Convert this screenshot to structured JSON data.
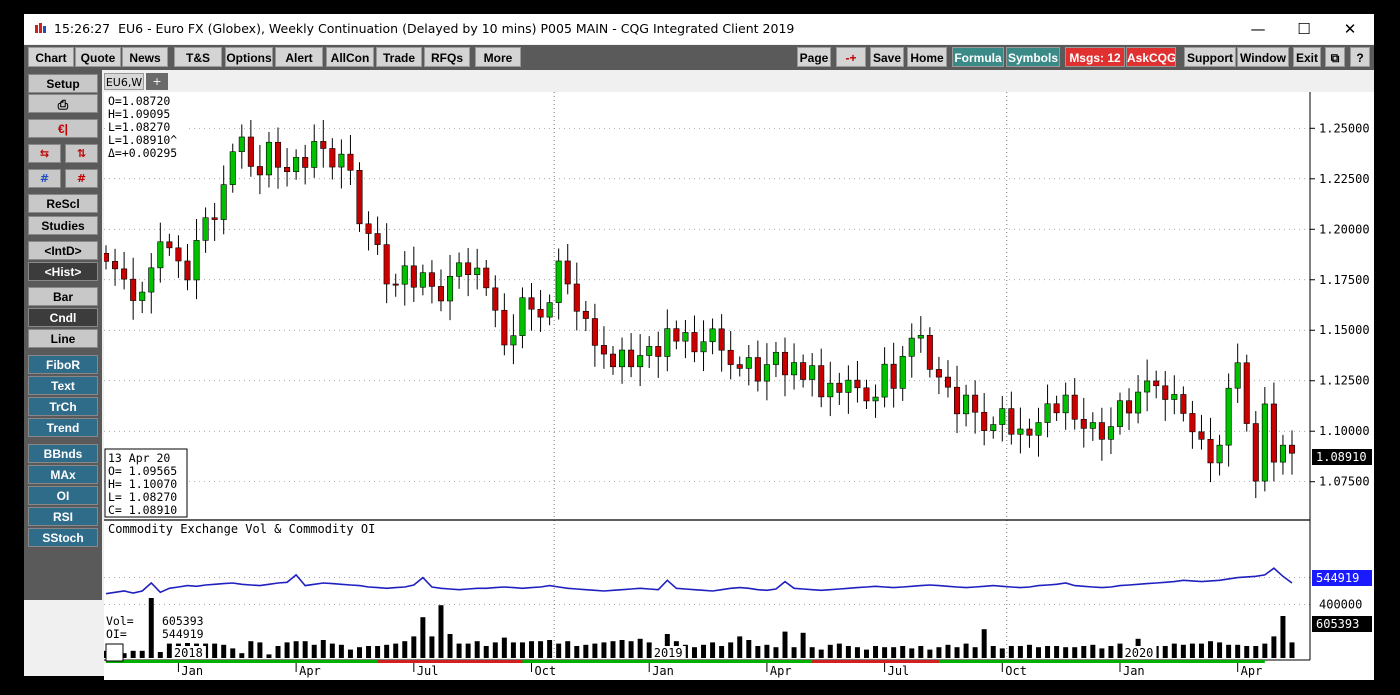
{
  "window": {
    "time": "15:26:27",
    "title": "EU6 - Euro FX (Globex), Weekly Continuation (Delayed by 10 mins)   P005 MAIN - CQG Integrated Client 2019"
  },
  "toolbar_left": [
    "Chart",
    "Quote",
    "News",
    "T&S",
    "Options",
    "Alert",
    "AllCon",
    "Trade",
    "RFQs",
    "More"
  ],
  "toolbar_right": {
    "page": "Page",
    "arrow": "-+",
    "save": "Save",
    "home": "Home",
    "formula": "Formula",
    "symbols": "Symbols",
    "msgs": "Msgs: 12",
    "askcqg": "AskCQG",
    "support": "Support",
    "window": "Window",
    "exit": "Exit",
    "restore": "⧉",
    "help": "?"
  },
  "sidebar": {
    "setup": "Setup",
    "resc": "ReScl",
    "studies": "Studies",
    "intd": "<IntD>",
    "hist": "<Hist>",
    "bar": "Bar",
    "cndl": "Cndl",
    "line": "Line",
    "fibor": "FiboR",
    "text": "Text",
    "trch": "TrCh",
    "trend": "Trend",
    "bbnds": "BBnds",
    "max": "MAx",
    "oi": "OI",
    "rsi": "RSI",
    "sstoch": "SStoch"
  },
  "tabs": {
    "active": "EU6,W",
    "add": "+"
  },
  "colors": {
    "up": "#00c000",
    "down": "#c80000",
    "oi_line": "#2020c0",
    "volume": "#000000",
    "oi_label_bg": "#1a1aff",
    "titlebar_bg": "#ffffff",
    "toolbar_bg": "#5a5a5a",
    "chart_bg": "#ffffff",
    "study_button": "#2f6c8a",
    "msgs_button": "#e03030",
    "formula_button": "#3a8a88"
  },
  "chart_data": [
    {
      "type": "candlestick",
      "instrument": "EU6",
      "ylim": [
        1.06,
        1.265
      ],
      "y_ticks": [
        "1.25000",
        "1.22500",
        "1.20000",
        "1.17500",
        "1.15000",
        "1.12500",
        "1.10000",
        "1.07500"
      ],
      "last_price": "1.08910",
      "x_labels": [
        "Jan",
        "Apr",
        "Jul",
        "Oct",
        "Jan",
        "Apr",
        "Jul",
        "Oct",
        "Jan",
        "Apr"
      ],
      "year_labels": [
        "2018",
        "2019",
        "2020"
      ],
      "grid": true,
      "info_top": [
        "O=1.08720",
        "H=1.09095",
        "L=1.08270",
        "L=1.08910^",
        "Δ=+0.00295"
      ],
      "info_bar": [
        "13 Apr 20",
        "O= 1.09565",
        "H= 1.10070",
        "L= 1.08270",
        "C= 1.08910"
      ],
      "close": [
        1.1841,
        1.1804,
        1.1753,
        1.1647,
        1.1689,
        1.1809,
        1.1938,
        1.1908,
        1.1843,
        1.1749,
        1.1945,
        1.2057,
        1.2048,
        1.2221,
        1.2384,
        1.2457,
        1.2311,
        1.2269,
        1.2431,
        1.2307,
        1.2285,
        1.2356,
        1.2306,
        1.2435,
        1.24,
        1.2308,
        1.2372,
        1.2292,
        1.2027,
        1.1979,
        1.1924,
        1.1729,
        1.1728,
        1.1819,
        1.1713,
        1.1785,
        1.1717,
        1.1645,
        1.1767,
        1.1834,
        1.1775,
        1.1808,
        1.171,
        1.1599,
        1.1427,
        1.1473,
        1.1661,
        1.1604,
        1.1565,
        1.1637,
        1.1843,
        1.1729,
        1.1594,
        1.1558,
        1.1425,
        1.1382,
        1.1319,
        1.1402,
        1.1319,
        1.1375,
        1.142,
        1.137,
        1.1508,
        1.1446,
        1.1489,
        1.1393,
        1.1443,
        1.1507,
        1.1401,
        1.133,
        1.1311,
        1.1365,
        1.1248,
        1.133,
        1.1391,
        1.1279,
        1.134,
        1.1256,
        1.1325,
        1.117,
        1.1238,
        1.1192,
        1.1253,
        1.1215,
        1.115,
        1.1169,
        1.1332,
        1.1212,
        1.1371,
        1.1461,
        1.1475,
        1.1306,
        1.1268,
        1.1218,
        1.1086,
        1.1179,
        1.1094,
        1.1003,
        1.1033,
        1.1112,
        1.0985,
        1.1011,
        1.098,
        1.1043,
        1.1136,
        1.1091,
        1.1179,
        1.1059,
        1.1014,
        1.1043,
        1.096,
        1.1023,
        1.1151,
        1.109,
        1.1194,
        1.1249,
        1.1225,
        1.1157,
        1.1182,
        1.1088,
        1.0997,
        1.096,
        1.0843,
        1.0931,
        1.1213,
        1.1339,
        1.1038,
        1.0753,
        1.1135,
        1.0847,
        1.0931,
        1.0891
      ],
      "volume": {
        "values": [
          12,
          6,
          8,
          12,
          12,
          100,
          10,
          24,
          24,
          25,
          24,
          24,
          24,
          22,
          16,
          8,
          28,
          26,
          6,
          20,
          26,
          28,
          28,
          22,
          30,
          24,
          22,
          14,
          18,
          20,
          20,
          22,
          24,
          28,
          36,
          68,
          36,
          88,
          40,
          24,
          24,
          28,
          20,
          26,
          34,
          26,
          26,
          28,
          28,
          30,
          24,
          28,
          20,
          22,
          24,
          26,
          28,
          30,
          28,
          32,
          26,
          18,
          40,
          28,
          22,
          18,
          22,
          26,
          20,
          26,
          36,
          30,
          20,
          22,
          18,
          44,
          18,
          42,
          18,
          14,
          22,
          24,
          20,
          18,
          14,
          20,
          18,
          18,
          20,
          16,
          20,
          14,
          18,
          22,
          18,
          24,
          18,
          48,
          20,
          16,
          20,
          20,
          22,
          18,
          20,
          20,
          18,
          18,
          20,
          22,
          16,
          20,
          24,
          18,
          32,
          20,
          20,
          20,
          24,
          22,
          24,
          24,
          28,
          26,
          22,
          22,
          20,
          20,
          24,
          36,
          70,
          26,
          24,
          24,
          26,
          24,
          22,
          20,
          14,
          20
        ],
        "ylim": [
          0,
          1000000
        ],
        "tick_labels": [
          "600000",
          "400000"
        ],
        "vol_label": "Vol=",
        "vol_value": "605393",
        "oi_label": "OI=",
        "oi_value": "544919",
        "last_vol_value": "605393",
        "last_oi_value": "544919"
      },
      "open_interest": [
        480000,
        490000,
        500000,
        485000,
        500000,
        560000,
        490000,
        520000,
        530000,
        540000,
        535000,
        545000,
        550000,
        555000,
        560000,
        550000,
        545000,
        540000,
        550000,
        560000,
        565000,
        620000,
        540000,
        550000,
        560000,
        555000,
        550000,
        545000,
        540000,
        530000,
        525000,
        520000,
        525000,
        530000,
        545000,
        600000,
        530000,
        520000,
        515000,
        510000,
        515000,
        520000,
        520000,
        525000,
        530000,
        525000,
        520000,
        525000,
        530000,
        540000,
        530000,
        520000,
        515000,
        510000,
        505000,
        500000,
        505000,
        510000,
        515000,
        520000,
        515000,
        510000,
        580000,
        520000,
        515000,
        510000,
        505000,
        500000,
        510000,
        520000,
        525000,
        520000,
        510000,
        505000,
        515000,
        570000,
        520000,
        515000,
        510000,
        505000,
        510000,
        515000,
        520000,
        525000,
        530000,
        535000,
        530000,
        525000,
        530000,
        535000,
        540000,
        545000,
        540000,
        535000,
        530000,
        525000,
        530000,
        535000,
        540000,
        535000,
        530000,
        525000,
        530000,
        540000,
        545000,
        550000,
        560000,
        540000,
        535000,
        530000,
        525000,
        530000,
        540000,
        545000,
        550000,
        555000,
        560000,
        565000,
        570000,
        580000,
        575000,
        570000,
        575000,
        580000,
        590000,
        600000,
        605000,
        610000,
        620000,
        670000,
        610000,
        560000,
        550000,
        545000,
        540000,
        545000,
        544919,
        544919,
        544919,
        544919
      ]
    }
  ]
}
